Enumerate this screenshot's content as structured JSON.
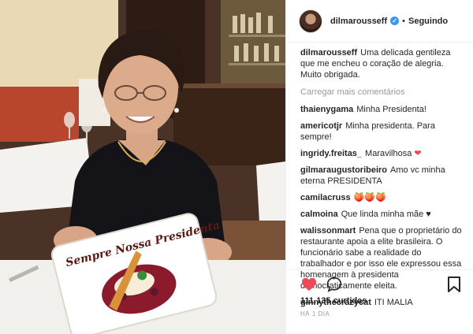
{
  "post": {
    "username": "dilmarousseff",
    "separator": "•",
    "follow_status": "Seguindo",
    "plate_text": "Sempre Nossa Presidenta",
    "caption": {
      "user": "dilmarousseff",
      "text": "Uma delicada gentileza que me encheu o coração de alegria. Muito obrigada."
    },
    "load_more": "Carregar mais comentários",
    "comments": [
      {
        "user": "thaienygama",
        "text": "Minha Presidenta!"
      },
      {
        "user": "americotjr",
        "text": "Minha presidenta. Para sempre!"
      },
      {
        "user": "ingridy.freitas_",
        "text": "Maravilhosa",
        "emoji": "❤"
      },
      {
        "user": "gilmaraugustoribeiro",
        "text": "Amo vc minha eterna PRESIDENTA"
      },
      {
        "user": "camilacruss",
        "text": "🍑🍑🍑"
      },
      {
        "user": "calmoina",
        "text": "Que linda minha mãe ♥"
      },
      {
        "user": "walissonmart",
        "text": "Pena que o proprietário do restaurante apoia a elite brasileira. O funcionário sabe a realidade do trabalhador e por isso ele expressou essa homenagem à presidenta democraticamente eleita."
      },
      {
        "user": "ginnythecrazycat",
        "text": "ITI MALIA"
      }
    ],
    "likes": "111.135 curtidas",
    "timestamp": "HÁ 1 DIA",
    "colors": {
      "heart": "#ed4956",
      "verified": "#3897f0",
      "muted": "#999999"
    },
    "icons": [
      "verified-icon",
      "heart-icon",
      "comment-icon",
      "bookmark-icon"
    ]
  }
}
